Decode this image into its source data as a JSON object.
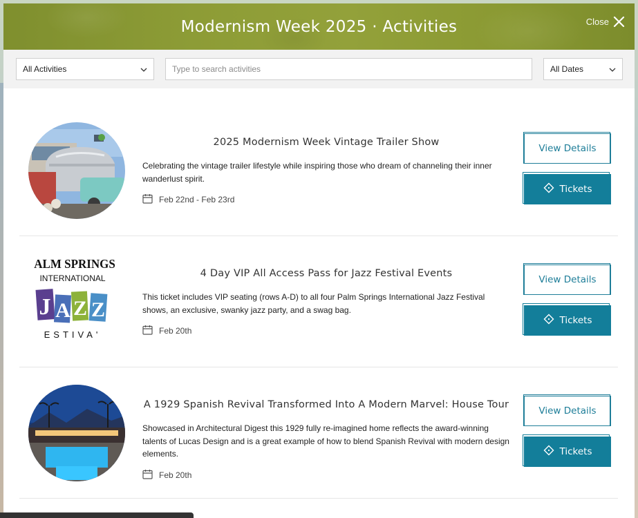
{
  "header": {
    "title": "Modernism Week 2025 · Activities",
    "close_label": "Close",
    "color": "#8d9c36"
  },
  "filters": {
    "category": {
      "value": "All Activities"
    },
    "search": {
      "placeholder": "Type to search activities"
    },
    "dates": {
      "value": "All Dates"
    }
  },
  "activities": [
    {
      "title": "2025 Modernism Week Vintage Trailer Show",
      "description": "Celebrating the vintage trailer lifestyle while inspiring those who dream of channeling their inner wanderlust spirit.",
      "date": "Feb 22nd - Feb 23rd",
      "view_label": "View Details",
      "tickets_label": "Tickets"
    },
    {
      "title": "4 Day VIP All Access Pass for Jazz Festival Events",
      "description": "This ticket includes VIP seating (rows A-D) to all four Palm Springs International Jazz Festival shows, an exclusive, swanky jazz party, and a swag bag.",
      "date": "Feb 20th",
      "view_label": "View Details",
      "tickets_label": "Tickets",
      "logo": {
        "line1": "ALM SPRINGS",
        "line2": "INTERNATIONAL",
        "letters": [
          "J",
          "A",
          "Z",
          "Z"
        ],
        "line3": "ESTIVA'"
      }
    },
    {
      "title": "A 1929 Spanish Revival Transformed Into A Modern Marvel: House Tour",
      "description": "Showcased in Architectural Digest this 1929 fully re-imagined home reflects the award-winning talents of Lucas Design and is a great example of how to blend Spanish Revival with modern design elements.",
      "date": "Feb 20th",
      "view_label": "View Details",
      "tickets_label": "Tickets"
    }
  ],
  "colors": {
    "accent": "#137e9a",
    "jazz_purple": "#5a3f8f",
    "jazz_green": "#8db23a",
    "jazz_blue": "#4a8fc7"
  }
}
